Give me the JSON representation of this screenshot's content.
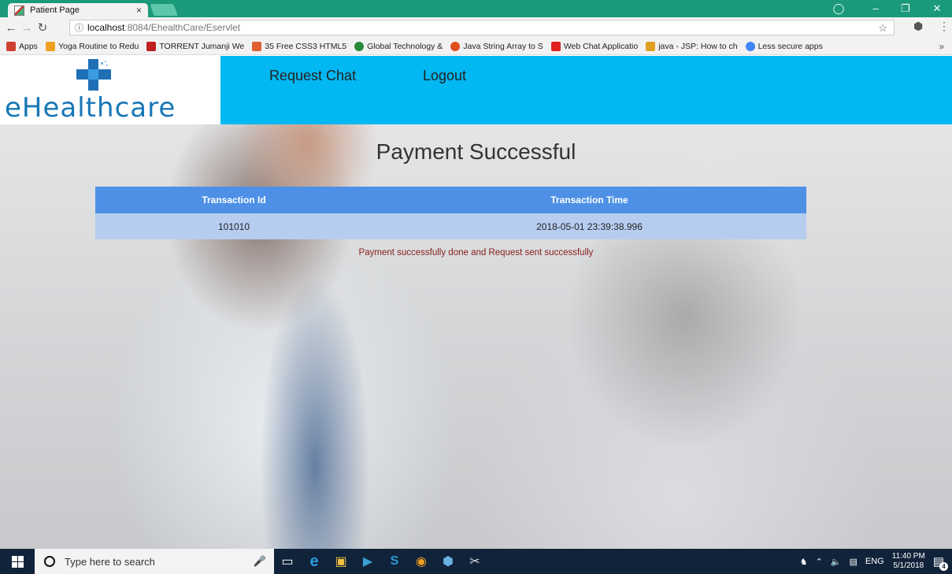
{
  "browser": {
    "tab_title": "Patient Page",
    "tab_close": "×",
    "url_host": "localhost",
    "url_path": ":8084/EhealthCare/Eservlet",
    "bookmarks": [
      {
        "label": "Apps",
        "color": "#d04030"
      },
      {
        "label": "Yoga Routine to Redu",
        "color": "#f0a020"
      },
      {
        "label": "TORRENT Jumanji We",
        "color": "#c02020"
      },
      {
        "label": "35 Free CSS3 HTML5",
        "color": "#e06030"
      },
      {
        "label": "Global Technology &",
        "color": "#2a8a3a"
      },
      {
        "label": "Java String Array to S",
        "color": "#e05020"
      },
      {
        "label": "Web Chat Applicatio",
        "color": "#e02020"
      },
      {
        "label": "java - JSP: How to ch",
        "color": "#e0a020"
      },
      {
        "label": "Less secure apps",
        "color": "#4285f4"
      }
    ],
    "bookmarks_more": "»"
  },
  "header": {
    "logo_text": "eHealthcare",
    "nav": [
      "Request Chat",
      "Logout"
    ]
  },
  "main": {
    "heading": "Payment Successful",
    "table": {
      "headers": [
        "Transaction Id",
        "Transaction Time"
      ],
      "rows": [
        [
          "101010",
          "2018-05-01 23:39:38.996"
        ]
      ]
    },
    "message": "Payment successfully done and Request sent successfully"
  },
  "taskbar": {
    "search_placeholder": "Type here to search",
    "language": "ENG",
    "time": "11:40 PM",
    "date": "5/1/2018",
    "notification_count": "4"
  },
  "colors": {
    "header_bg": "#02b8f2",
    "table_header": "#4d90e6",
    "table_row": "#b6cdf0",
    "message": "#8b1c1c"
  }
}
